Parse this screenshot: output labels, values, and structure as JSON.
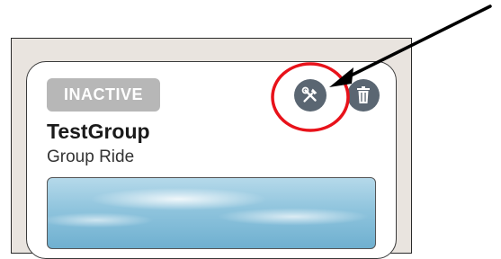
{
  "card": {
    "status_badge": "INACTIVE",
    "title": "TestGroup",
    "subtitle": "Group Ride"
  },
  "actions": {
    "edit_icon": "tools-icon",
    "delete_icon": "trash-icon"
  },
  "annotation": {
    "highlight_color": "#e8121a",
    "arrow_color": "#000000"
  },
  "colors": {
    "badge_bg": "#b7b7b7",
    "icon_button_bg": "#5a6672"
  }
}
